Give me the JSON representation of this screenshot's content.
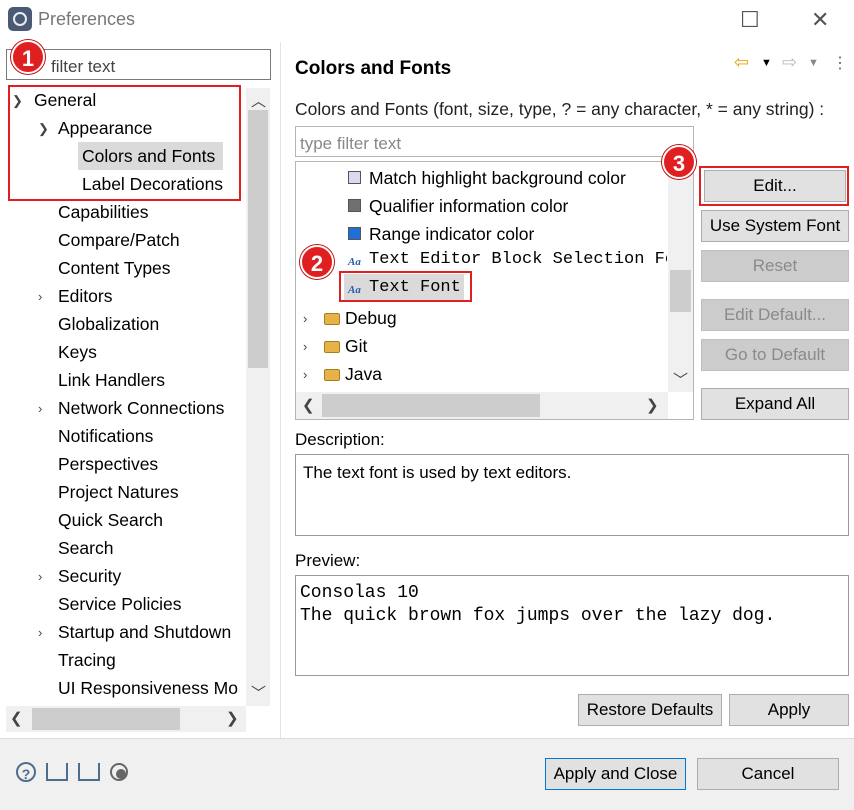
{
  "window": {
    "title": "Preferences",
    "maximize_glyph": "☐",
    "close_glyph": "✕"
  },
  "left": {
    "filter_placeholder": "filter text",
    "tree": {
      "general": "General",
      "appearance": "Appearance",
      "colors_fonts": "Colors and Fonts",
      "label_decorations": "Label Decorations",
      "items": [
        "Capabilities",
        "Compare/Patch",
        "Content Types",
        "Editors",
        "Globalization",
        "Keys",
        "Link Handlers",
        "Network Connections",
        "Notifications",
        "Perspectives",
        "Project Natures",
        "Quick Search",
        "Search",
        "Security",
        "Service Policies",
        "Startup and Shutdown",
        "Tracing",
        "UI Responsiveness Mo"
      ]
    }
  },
  "right": {
    "title": "Colors and Fonts",
    "description_line": "Colors and Fonts (font, size, type, ? = any character, * = any string) :",
    "filter_placeholder": "type filter text",
    "list": {
      "match_highlight": "Match highlight background color",
      "qualifier_info": "Qualifier information color",
      "range_indicator": "Range indicator color",
      "block_selection": "Text Editor Block Selection Fo",
      "text_font": "Text Font",
      "debug": "Debug",
      "git": "Git",
      "java": "Java"
    },
    "buttons": {
      "edit": "Edit...",
      "use_system_font": "Use System Font",
      "reset": "Reset",
      "edit_default": "Edit Default...",
      "go_to_default": "Go to Default",
      "expand_all": "Expand All"
    },
    "description_label": "Description:",
    "description_text": "The text font is used by text editors.",
    "preview_label": "Preview:",
    "preview_line1": "Consolas 10",
    "preview_line2": "The quick brown fox jumps over the lazy dog.",
    "restore_defaults": "Restore Defaults",
    "apply": "Apply"
  },
  "bottom": {
    "apply_close": "Apply and Close",
    "cancel": "Cancel"
  },
  "badges": {
    "b1": "1",
    "b2": "2",
    "b3": "3"
  },
  "colors": {
    "annotation_red": "#e02020",
    "selection_gray": "#dadada",
    "range_blue": "#1f6fd6"
  }
}
